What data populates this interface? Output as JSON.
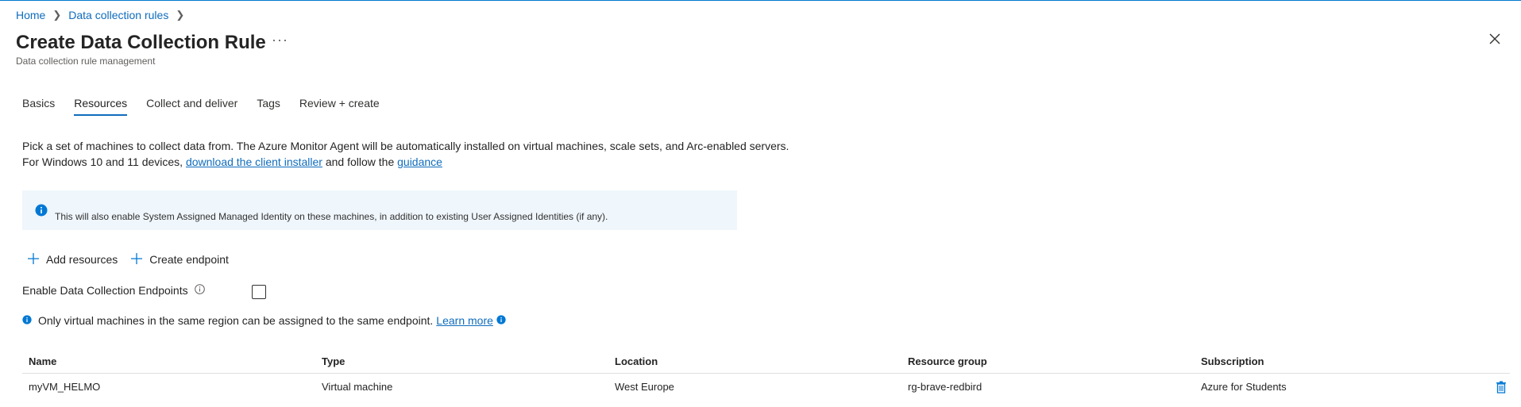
{
  "breadcrumb": {
    "items": [
      "Home",
      "Data collection rules"
    ]
  },
  "header": {
    "title": "Create Data Collection Rule",
    "subtitle": "Data collection rule management",
    "more_label": "···"
  },
  "tabs": [
    {
      "label": "Basics"
    },
    {
      "label": "Resources",
      "active": true
    },
    {
      "label": "Collect and deliver"
    },
    {
      "label": "Tags"
    },
    {
      "label": "Review + create"
    }
  ],
  "description": {
    "line1": "Pick a set of machines to collect data from. The Azure Monitor Agent will be automatically installed on virtual machines, scale sets, and Arc-enabled servers.",
    "line2_prefix": "For Windows 10 and 11 devices, ",
    "link1": "download the client installer",
    "line2_middle": " and follow the ",
    "link2": "guidance"
  },
  "info_box": {
    "message": "This will also enable System Assigned Managed Identity on these machines, in addition to existing User Assigned Identities (if any)."
  },
  "commands": {
    "add_resources": "Add resources",
    "create_endpoint": "Create endpoint"
  },
  "endpoints": {
    "label": "Enable Data Collection Endpoints",
    "checked": false
  },
  "notice": {
    "text": "Only virtual machines in the same region can be assigned to the same endpoint.",
    "link": "Learn more"
  },
  "table": {
    "columns": [
      "Name",
      "Type",
      "Location",
      "Resource group",
      "Subscription"
    ],
    "rows": [
      [
        "myVM_HELMO",
        "Virtual machine",
        "West Europe",
        "rg-brave-redbird",
        "Azure for Students"
      ]
    ]
  },
  "colors": {
    "accent": "#0f6cbd",
    "info_bg": "#eff6fc",
    "icon_blue": "#0078d4"
  }
}
